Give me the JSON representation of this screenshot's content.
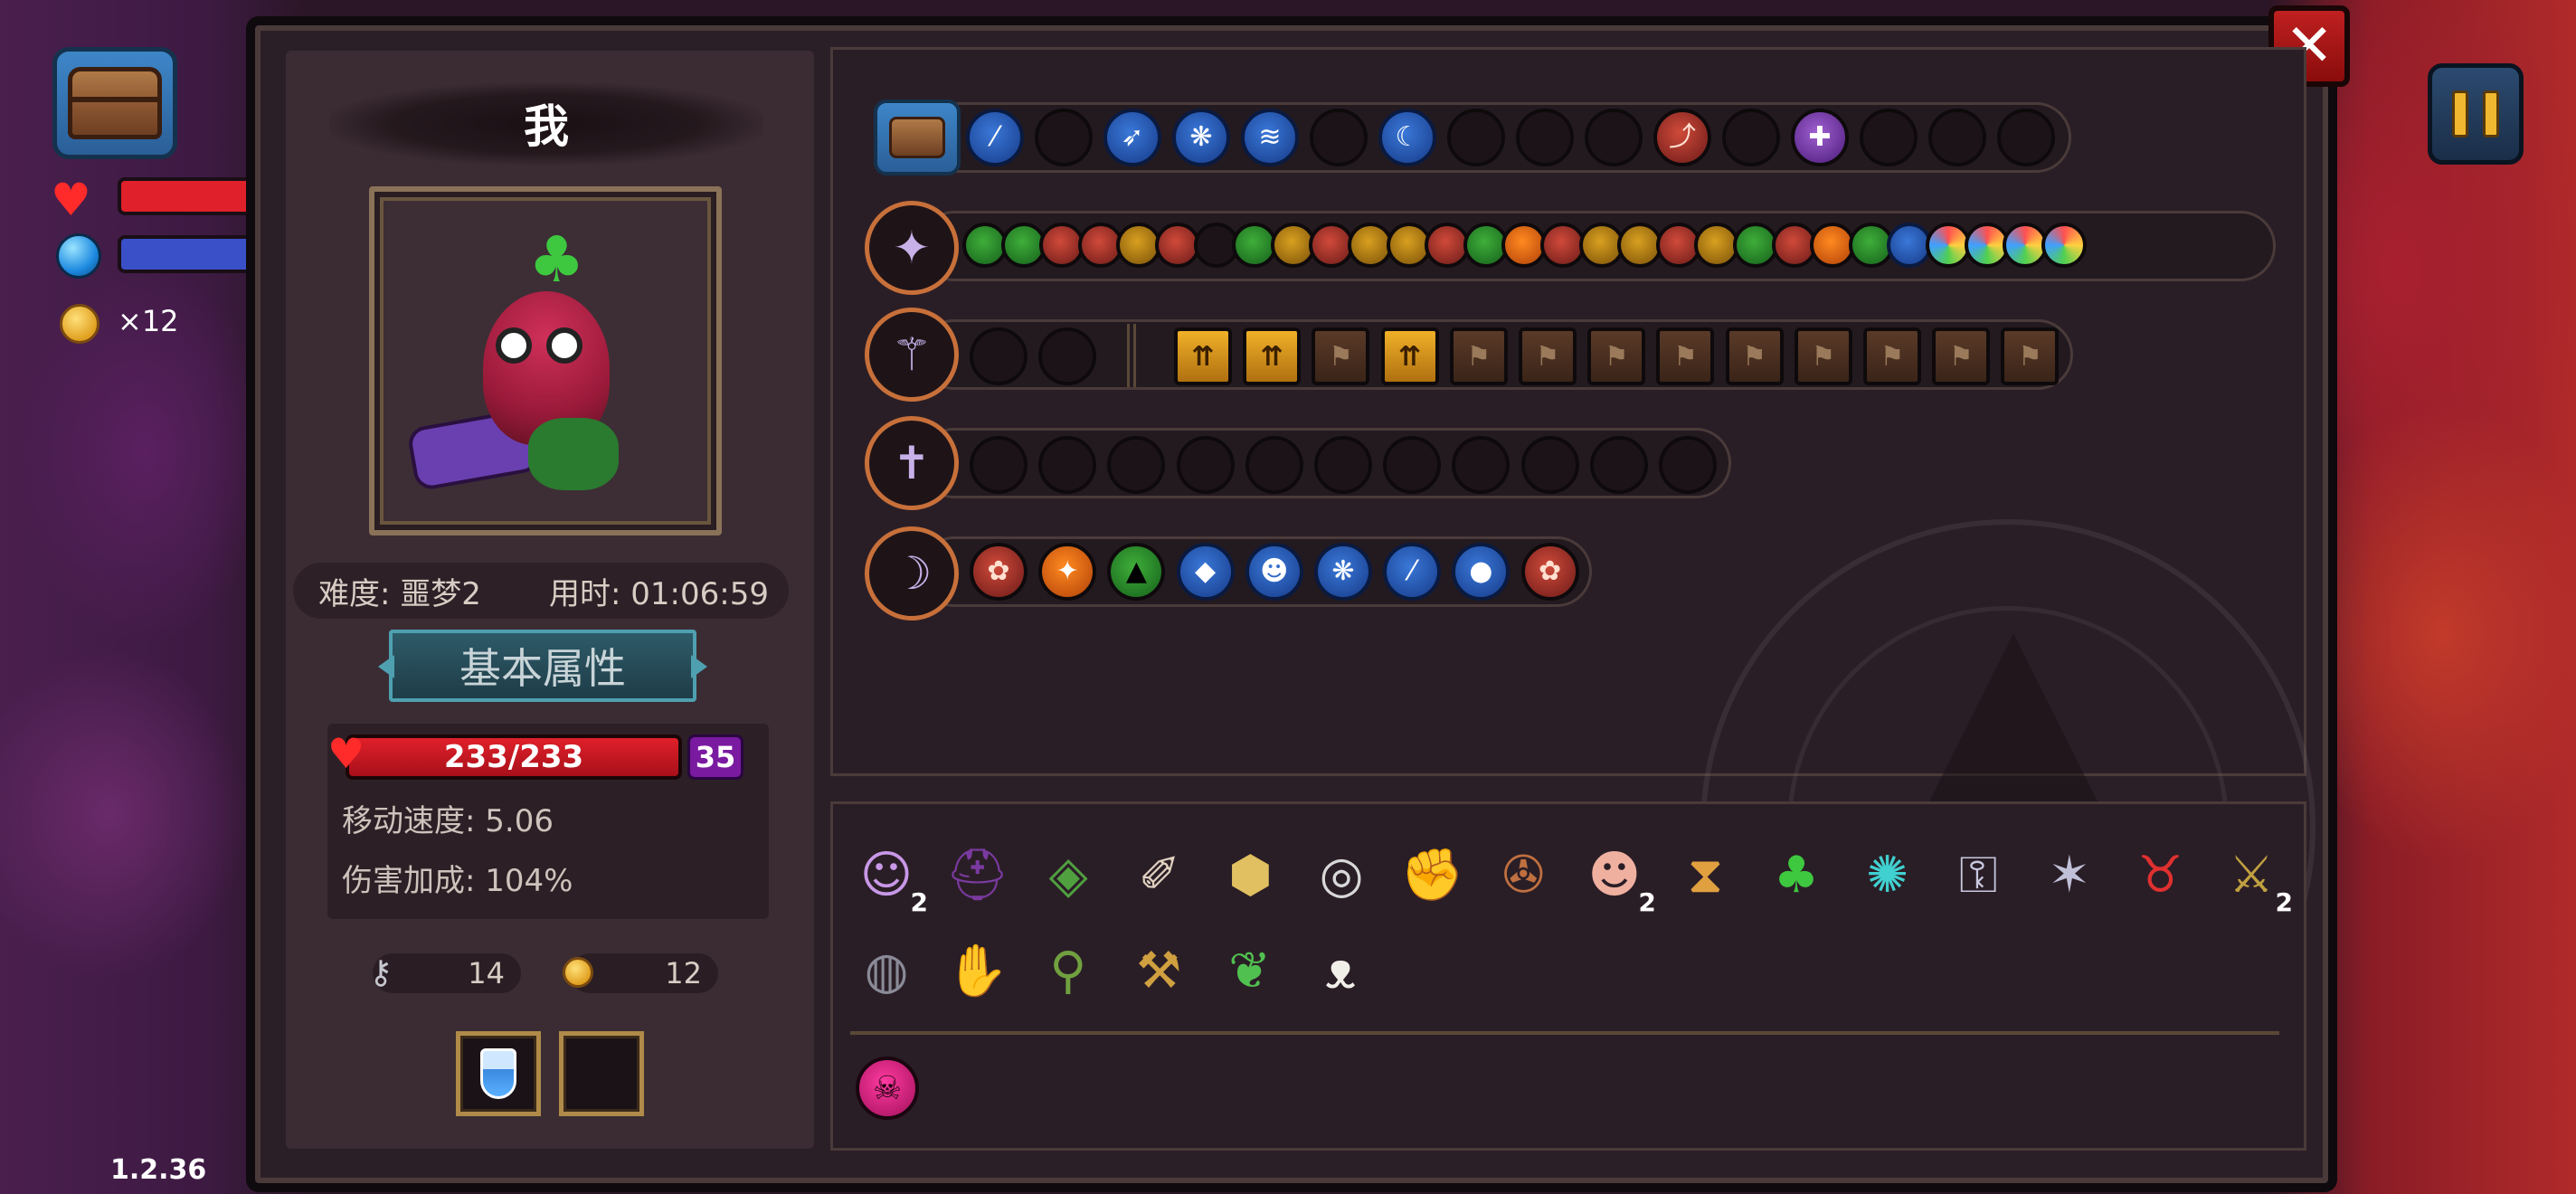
{
  "hud": {
    "coin_count": "×12",
    "version": "1.2.36"
  },
  "panel": {
    "player_name": "我",
    "difficulty": "难度: 噩梦2",
    "time_used": "用时: 01:06:59",
    "section_tab": "基本属性",
    "hp": "233/233",
    "level": "35",
    "move_speed": "移动速度: 5.06",
    "damage_bonus": "伤害加成: 104%",
    "keys": "14",
    "coins": "12"
  },
  "weapons": [
    {
      "name": "chest-slot-row"
    },
    {
      "name": "shuriken-staff"
    },
    {
      "name": "purple-wand"
    },
    {
      "name": "cross-staff"
    },
    {
      "name": "purple-blade"
    }
  ],
  "items": {
    "counts": {
      "witch": "2",
      "head": "2",
      "sword": "2"
    }
  },
  "colors": {
    "panel_bg": "#2b1f27",
    "hp_red": "#e0202a",
    "level_purple": "#7a1aa0",
    "tab_teal": "#2e5a68",
    "close_red": "#c02020",
    "slot_blue": "#3a78d8",
    "slot_green": "#3fae3a"
  }
}
